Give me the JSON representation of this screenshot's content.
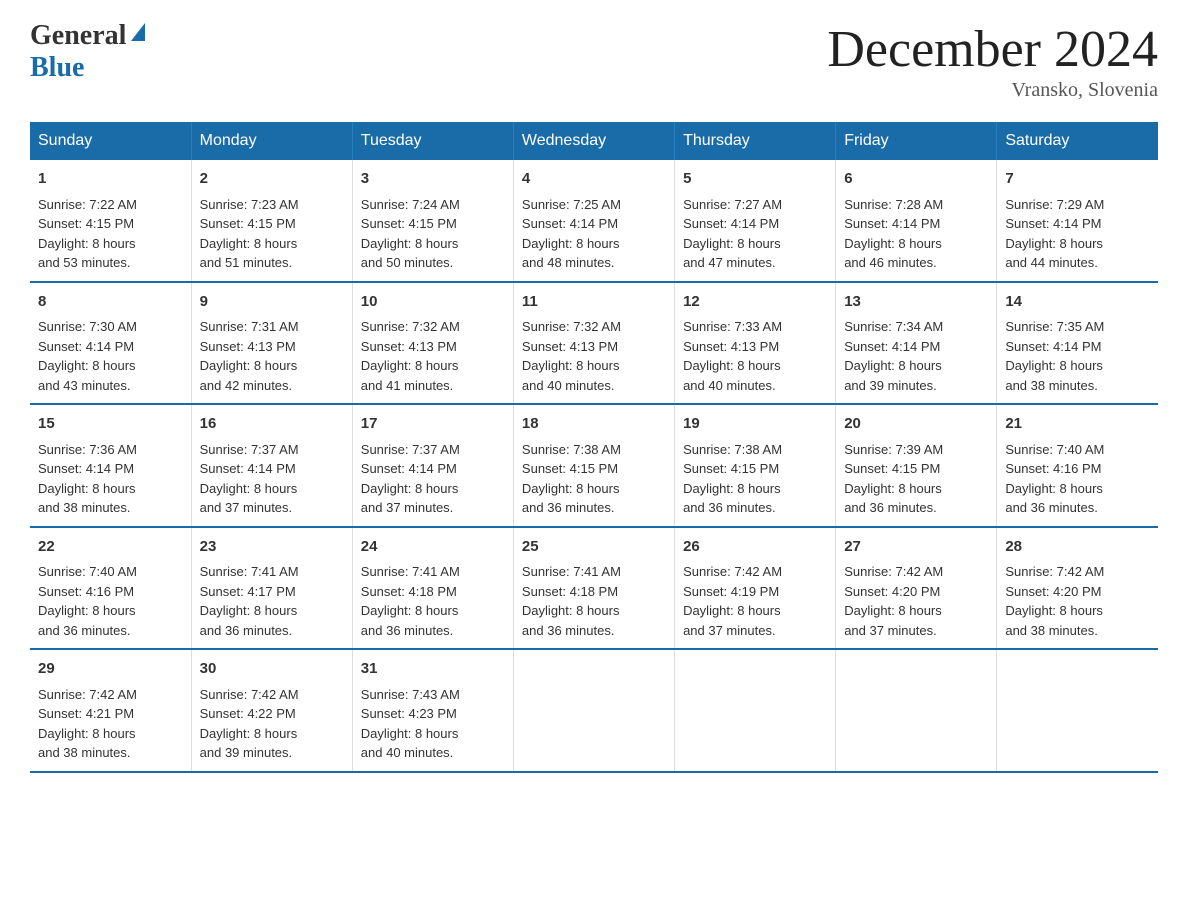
{
  "header": {
    "logo_general": "General",
    "logo_blue": "Blue",
    "month_title": "December 2024",
    "location": "Vransko, Slovenia"
  },
  "weekdays": [
    "Sunday",
    "Monday",
    "Tuesday",
    "Wednesday",
    "Thursday",
    "Friday",
    "Saturday"
  ],
  "weeks": [
    [
      {
        "day": "1",
        "sunrise": "7:22 AM",
        "sunset": "4:15 PM",
        "daylight": "8 hours and 53 minutes."
      },
      {
        "day": "2",
        "sunrise": "7:23 AM",
        "sunset": "4:15 PM",
        "daylight": "8 hours and 51 minutes."
      },
      {
        "day": "3",
        "sunrise": "7:24 AM",
        "sunset": "4:15 PM",
        "daylight": "8 hours and 50 minutes."
      },
      {
        "day": "4",
        "sunrise": "7:25 AM",
        "sunset": "4:14 PM",
        "daylight": "8 hours and 48 minutes."
      },
      {
        "day": "5",
        "sunrise": "7:27 AM",
        "sunset": "4:14 PM",
        "daylight": "8 hours and 47 minutes."
      },
      {
        "day": "6",
        "sunrise": "7:28 AM",
        "sunset": "4:14 PM",
        "daylight": "8 hours and 46 minutes."
      },
      {
        "day": "7",
        "sunrise": "7:29 AM",
        "sunset": "4:14 PM",
        "daylight": "8 hours and 44 minutes."
      }
    ],
    [
      {
        "day": "8",
        "sunrise": "7:30 AM",
        "sunset": "4:14 PM",
        "daylight": "8 hours and 43 minutes."
      },
      {
        "day": "9",
        "sunrise": "7:31 AM",
        "sunset": "4:13 PM",
        "daylight": "8 hours and 42 minutes."
      },
      {
        "day": "10",
        "sunrise": "7:32 AM",
        "sunset": "4:13 PM",
        "daylight": "8 hours and 41 minutes."
      },
      {
        "day": "11",
        "sunrise": "7:32 AM",
        "sunset": "4:13 PM",
        "daylight": "8 hours and 40 minutes."
      },
      {
        "day": "12",
        "sunrise": "7:33 AM",
        "sunset": "4:13 PM",
        "daylight": "8 hours and 40 minutes."
      },
      {
        "day": "13",
        "sunrise": "7:34 AM",
        "sunset": "4:14 PM",
        "daylight": "8 hours and 39 minutes."
      },
      {
        "day": "14",
        "sunrise": "7:35 AM",
        "sunset": "4:14 PM",
        "daylight": "8 hours and 38 minutes."
      }
    ],
    [
      {
        "day": "15",
        "sunrise": "7:36 AM",
        "sunset": "4:14 PM",
        "daylight": "8 hours and 38 minutes."
      },
      {
        "day": "16",
        "sunrise": "7:37 AM",
        "sunset": "4:14 PM",
        "daylight": "8 hours and 37 minutes."
      },
      {
        "day": "17",
        "sunrise": "7:37 AM",
        "sunset": "4:14 PM",
        "daylight": "8 hours and 37 minutes."
      },
      {
        "day": "18",
        "sunrise": "7:38 AM",
        "sunset": "4:15 PM",
        "daylight": "8 hours and 36 minutes."
      },
      {
        "day": "19",
        "sunrise": "7:38 AM",
        "sunset": "4:15 PM",
        "daylight": "8 hours and 36 minutes."
      },
      {
        "day": "20",
        "sunrise": "7:39 AM",
        "sunset": "4:15 PM",
        "daylight": "8 hours and 36 minutes."
      },
      {
        "day": "21",
        "sunrise": "7:40 AM",
        "sunset": "4:16 PM",
        "daylight": "8 hours and 36 minutes."
      }
    ],
    [
      {
        "day": "22",
        "sunrise": "7:40 AM",
        "sunset": "4:16 PM",
        "daylight": "8 hours and 36 minutes."
      },
      {
        "day": "23",
        "sunrise": "7:41 AM",
        "sunset": "4:17 PM",
        "daylight": "8 hours and 36 minutes."
      },
      {
        "day": "24",
        "sunrise": "7:41 AM",
        "sunset": "4:18 PM",
        "daylight": "8 hours and 36 minutes."
      },
      {
        "day": "25",
        "sunrise": "7:41 AM",
        "sunset": "4:18 PM",
        "daylight": "8 hours and 36 minutes."
      },
      {
        "day": "26",
        "sunrise": "7:42 AM",
        "sunset": "4:19 PM",
        "daylight": "8 hours and 37 minutes."
      },
      {
        "day": "27",
        "sunrise": "7:42 AM",
        "sunset": "4:20 PM",
        "daylight": "8 hours and 37 minutes."
      },
      {
        "day": "28",
        "sunrise": "7:42 AM",
        "sunset": "4:20 PM",
        "daylight": "8 hours and 38 minutes."
      }
    ],
    [
      {
        "day": "29",
        "sunrise": "7:42 AM",
        "sunset": "4:21 PM",
        "daylight": "8 hours and 38 minutes."
      },
      {
        "day": "30",
        "sunrise": "7:42 AM",
        "sunset": "4:22 PM",
        "daylight": "8 hours and 39 minutes."
      },
      {
        "day": "31",
        "sunrise": "7:43 AM",
        "sunset": "4:23 PM",
        "daylight": "8 hours and 40 minutes."
      },
      null,
      null,
      null,
      null
    ]
  ],
  "labels": {
    "sunrise": "Sunrise:",
    "sunset": "Sunset:",
    "daylight": "Daylight:"
  }
}
